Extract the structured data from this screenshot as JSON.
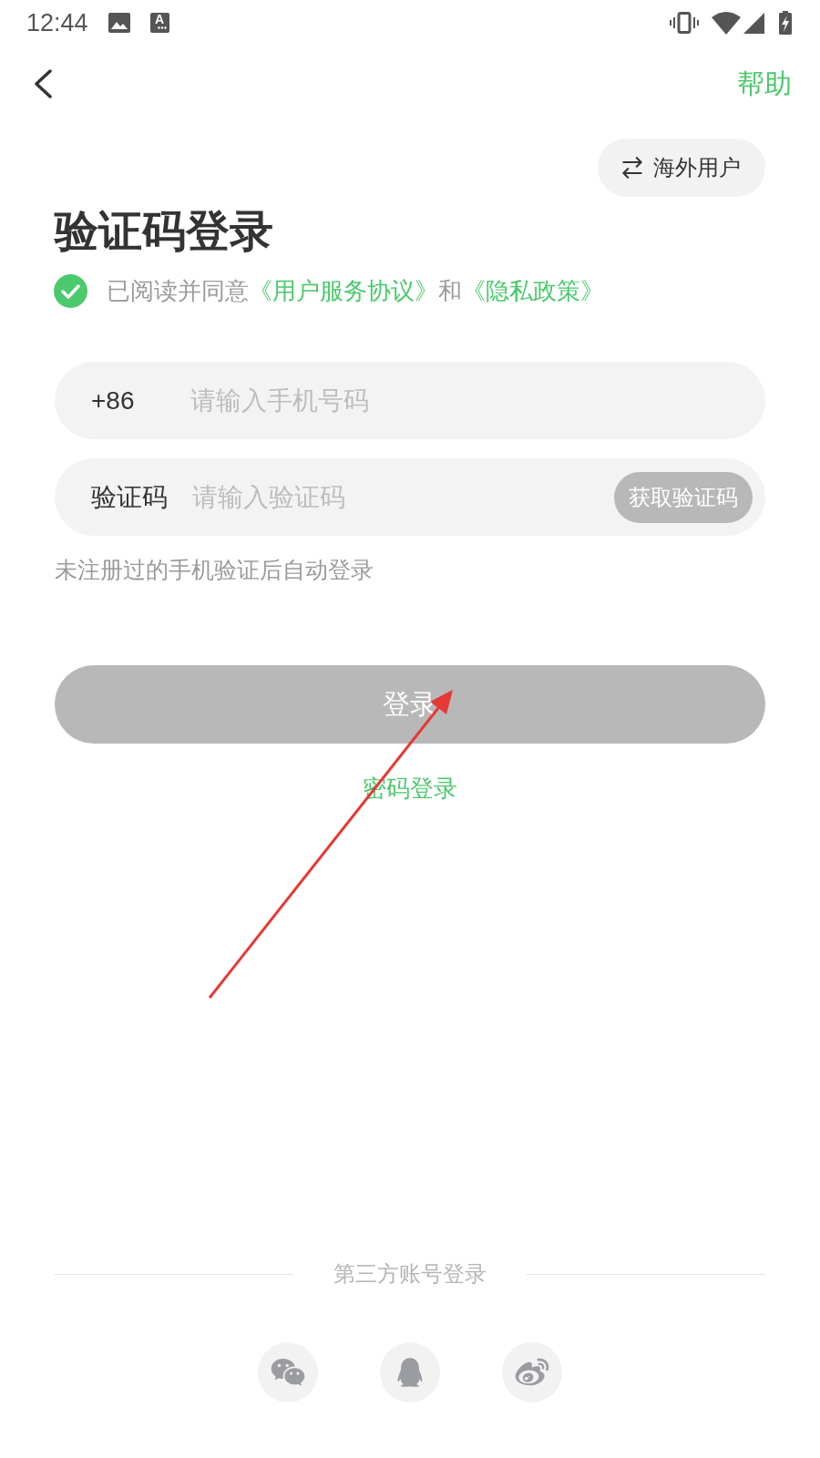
{
  "status_bar": {
    "time": "12:44",
    "notification_letter": "A"
  },
  "header": {
    "help": "帮助"
  },
  "overseas_button": {
    "label": "海外用户"
  },
  "title": "验证码登录",
  "agreement": {
    "checked": true,
    "text": "已阅读并同意",
    "link_1": "《用户服务协议》",
    "conjunction": "和",
    "link_2": "《隐私政策》"
  },
  "phone_field": {
    "prefix": "+86",
    "placeholder": "请输入手机号码"
  },
  "code_field": {
    "label": "验证码",
    "placeholder": "请输入验证码",
    "button": {
      "label": "获取验证码",
      "disabled": true
    }
  },
  "hint": "未注册过的手机验证后自动登录",
  "login_button": {
    "label": "登录",
    "disabled": true
  },
  "password_login": "密码登录",
  "third_party": {
    "title": "第三方账号登录"
  }
}
